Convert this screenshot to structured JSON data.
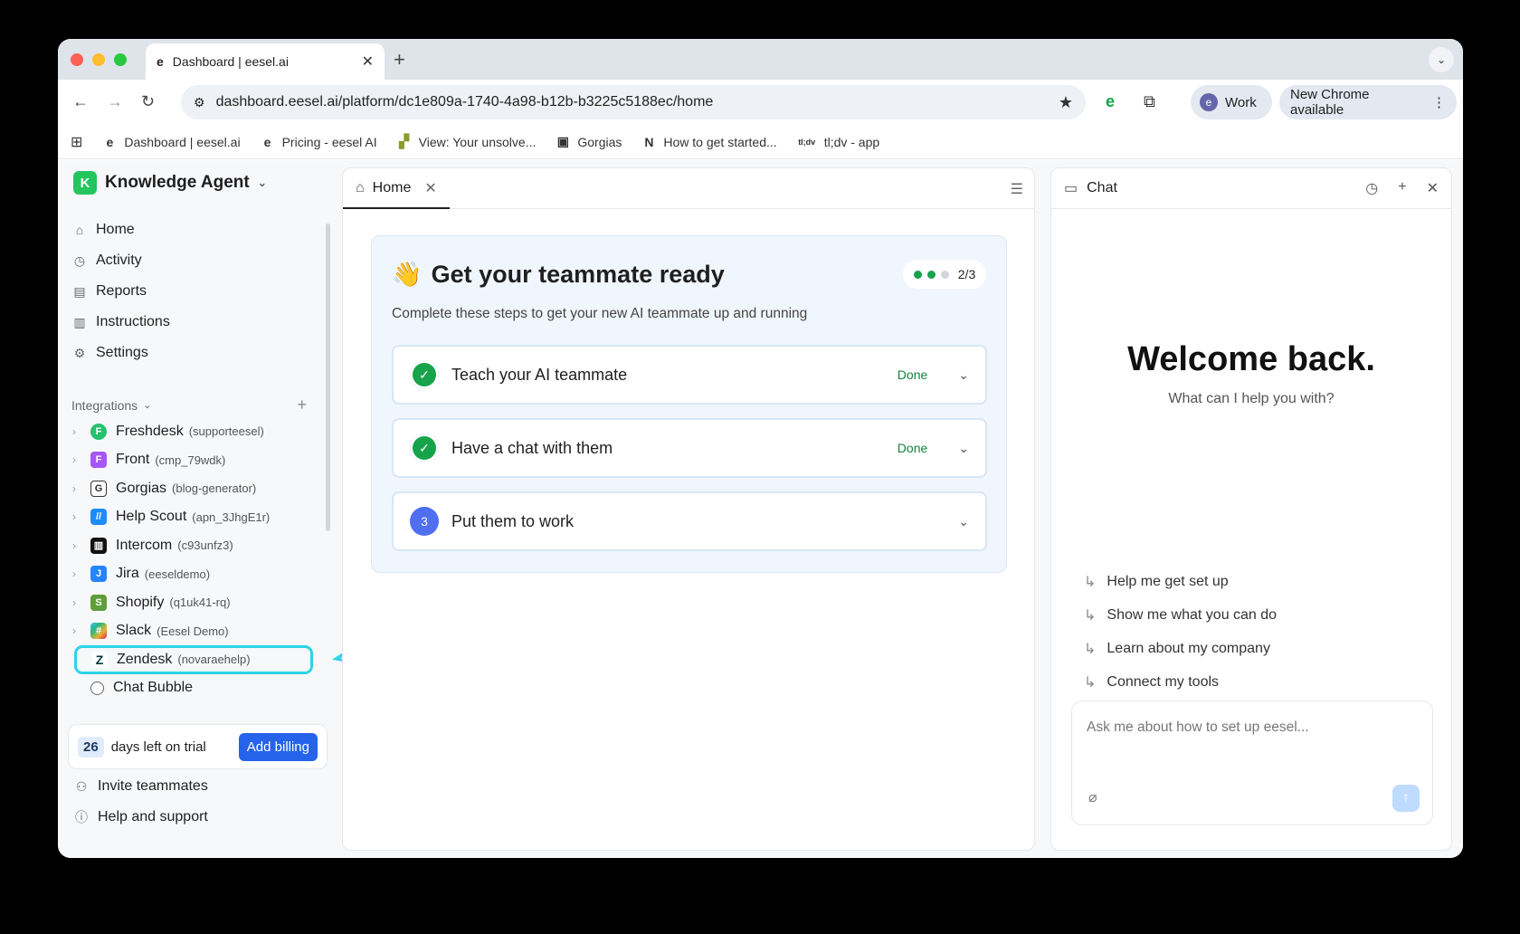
{
  "browser": {
    "tab_title": "Dashboard | eesel.ai",
    "url": "dashboard.eesel.ai/platform/dc1e809a-1740-4a98-b12b-b3225c5188ec/home",
    "profile": "Work",
    "profile_initial": "e",
    "update_label": "New Chrome available",
    "bookmarks": [
      {
        "icon": "e",
        "label": "Dashboard | eesel.ai"
      },
      {
        "icon": "e",
        "label": "Pricing - eesel AI"
      },
      {
        "icon": "zendesk",
        "label": "View: Your unsolve..."
      },
      {
        "icon": "gorgias",
        "label": "Gorgias"
      },
      {
        "icon": "notion",
        "label": "How to get started..."
      },
      {
        "icon": "tldv",
        "icon_text": "tl;dv",
        "label": "tl;dv - app"
      }
    ]
  },
  "sidebar": {
    "workspace_initial": "K",
    "workspace": "Knowledge Agent",
    "nav": [
      "Home",
      "Activity",
      "Reports",
      "Instructions",
      "Settings"
    ],
    "integrations_label": "Integrations",
    "integrations": [
      {
        "name": "Freshdesk",
        "sub": "(supporteesel)",
        "color": "#25c16f",
        "icon": "F"
      },
      {
        "name": "Front",
        "sub": "(cmp_79wdk)",
        "color": "#a855f7",
        "icon": "F"
      },
      {
        "name": "Gorgias",
        "sub": "(blog-generator)",
        "color": "#333333",
        "icon": "G"
      },
      {
        "name": "Help Scout",
        "sub": "(apn_3JhgE1r)",
        "color": "#1d8cf8",
        "icon": "H"
      },
      {
        "name": "Intercom",
        "sub": "(c93unfz3)",
        "color": "#111111",
        "icon": "I"
      },
      {
        "name": "Jira",
        "sub": "(eeseldemo)",
        "color": "#2684ff",
        "icon": "J"
      },
      {
        "name": "Shopify",
        "sub": "(q1uk41-rq)",
        "color": "#5e9e3b",
        "icon": "S"
      },
      {
        "name": "Slack",
        "sub": "(Eesel Demo)",
        "color": "#e01e5a",
        "icon": "S"
      },
      {
        "name": "Zendesk",
        "sub": "(novaraehelp)",
        "color": "#03363d",
        "icon": "Z"
      },
      {
        "name": "Chat Bubble",
        "sub": "",
        "color": "#ffffff",
        "icon": ""
      }
    ],
    "trial_days": "26",
    "trial_text": "days left on trial",
    "billing_button": "Add billing",
    "bottom": [
      "Invite teammates",
      "Help and support"
    ]
  },
  "main": {
    "tab": "Home",
    "card": {
      "emoji": "👋",
      "title": "Get your teammate ready",
      "progress": "2/3",
      "progress_done": 2,
      "progress_total": 3,
      "subtitle": "Complete these steps to get your new AI teammate up and running",
      "steps": [
        {
          "label": "Teach your AI teammate",
          "status": "Done",
          "marker": "✓"
        },
        {
          "label": "Have a chat with them",
          "status": "Done",
          "marker": "✓"
        },
        {
          "label": "Put them to work",
          "status": "",
          "marker": "3"
        }
      ]
    }
  },
  "chat": {
    "title": "Chat",
    "welcome": "Welcome back.",
    "subtitle": "What can I help you with?",
    "suggestions": [
      "Help me get set up",
      "Show me what you can do",
      "Learn about my company",
      "Connect my tools"
    ],
    "placeholder": "Ask me about how to set up eesel..."
  },
  "colors": {
    "accent": "#2563eb",
    "success": "#16a34a",
    "highlight": "#2dd4e8"
  }
}
